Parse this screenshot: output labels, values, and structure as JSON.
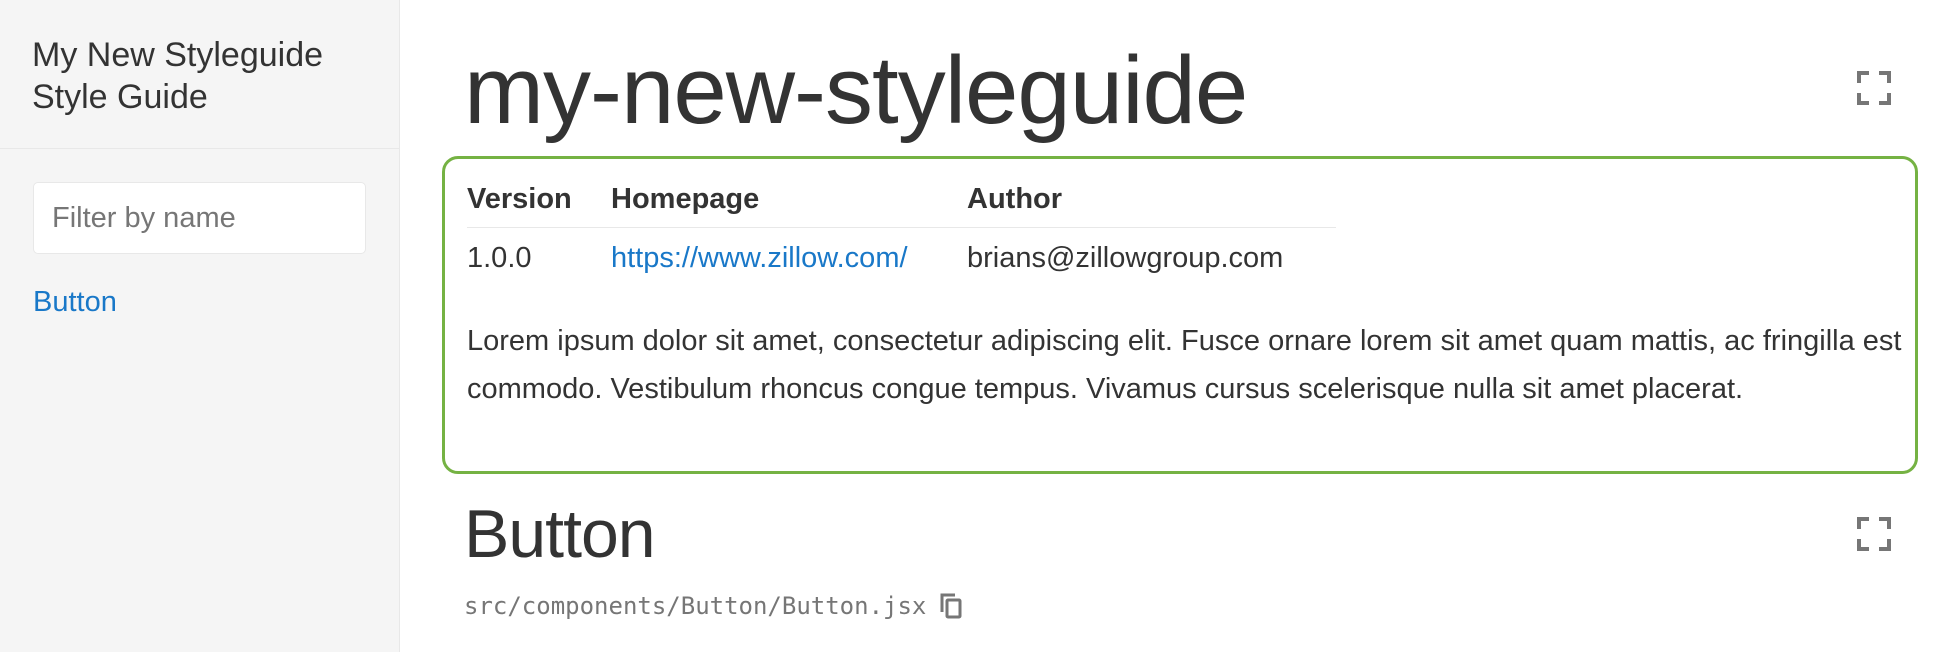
{
  "sidebar": {
    "title": "My New Styleguide Style Guide",
    "filter": {
      "placeholder": "Filter by name",
      "value": ""
    },
    "items": [
      {
        "label": "Button"
      }
    ]
  },
  "main": {
    "title": "my-new-styleguide",
    "meta": {
      "headers": [
        "Version",
        "Homepage",
        "Author"
      ],
      "row": [
        "1.0.0",
        "https://www.zillow.com/",
        "brians@zillowgroup.com"
      ]
    },
    "description": "Lorem ipsum dolor sit amet, consectetur adipiscing elit. Fusce ornare lorem sit amet quam mattis, ac fringilla est commodo. Vestibulum rhoncus congue tempus. Vivamus cursus scelerisque nulla sit amet placerat.",
    "section": {
      "title": "Button",
      "path": "src/components/Button/Button.jsx"
    }
  },
  "colors": {
    "link": "#1978c8",
    "highlight_border": "#75b243",
    "sidebar_bg": "#f5f5f5",
    "text": "#333333",
    "muted": "#767676"
  },
  "icons": {
    "isolate": "fullscreen-icon",
    "copy": "copy-icon"
  }
}
